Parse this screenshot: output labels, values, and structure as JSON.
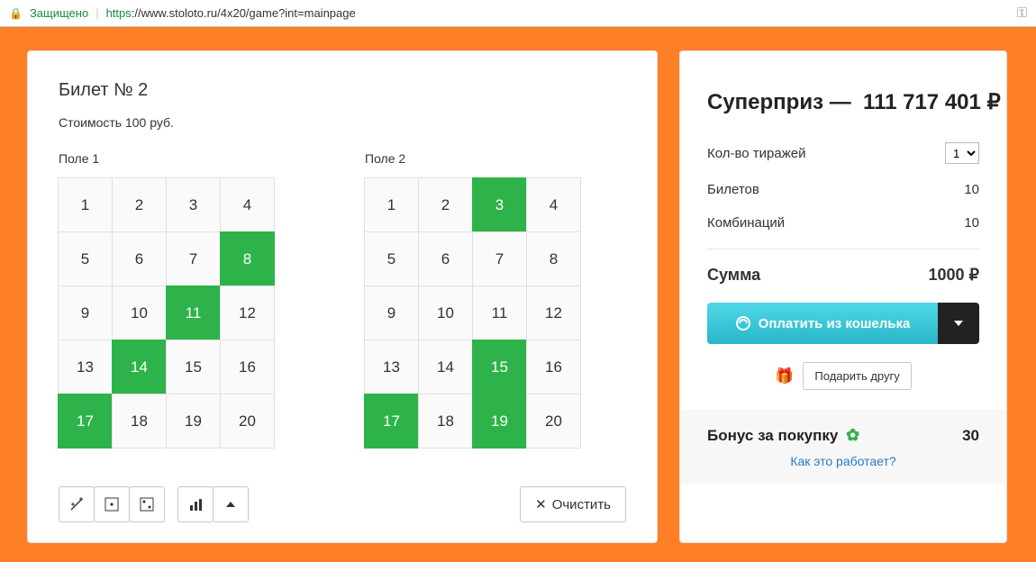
{
  "addrbar": {
    "secure": "Защищено",
    "url_proto": "https",
    "url_rest": "://www.stoloto.ru/4x20/game?int=mainpage"
  },
  "ticket": {
    "title": "Билет № 2",
    "cost": "Стоимость 100 руб.",
    "field1_label": "Поле 1",
    "field2_label": "Поле 2",
    "numbers": [
      "1",
      "2",
      "3",
      "4",
      "5",
      "6",
      "7",
      "8",
      "9",
      "10",
      "11",
      "12",
      "13",
      "14",
      "15",
      "16",
      "17",
      "18",
      "19",
      "20"
    ],
    "field1_selected": [
      8,
      11,
      14,
      17
    ],
    "field2_selected": [
      3,
      15,
      17,
      19
    ]
  },
  "toolbar": {
    "clear": "Очистить"
  },
  "summary": {
    "jackpot_label": "Суперприз —",
    "jackpot_value": "111 717 401 ₽",
    "draws_label": "Кол-во тиражей",
    "draws_value": "1",
    "tickets_label": "Билетов",
    "tickets_value": "10",
    "combos_label": "Комбинаций",
    "combos_value": "10",
    "sum_label": "Сумма",
    "sum_value": "1000 ₽",
    "pay_label": "Оплатить из кошелька",
    "gift_label": "Подарить другу",
    "bonus_label": "Бонус за покупку",
    "bonus_value": "30",
    "how_link": "Как это работает?"
  }
}
